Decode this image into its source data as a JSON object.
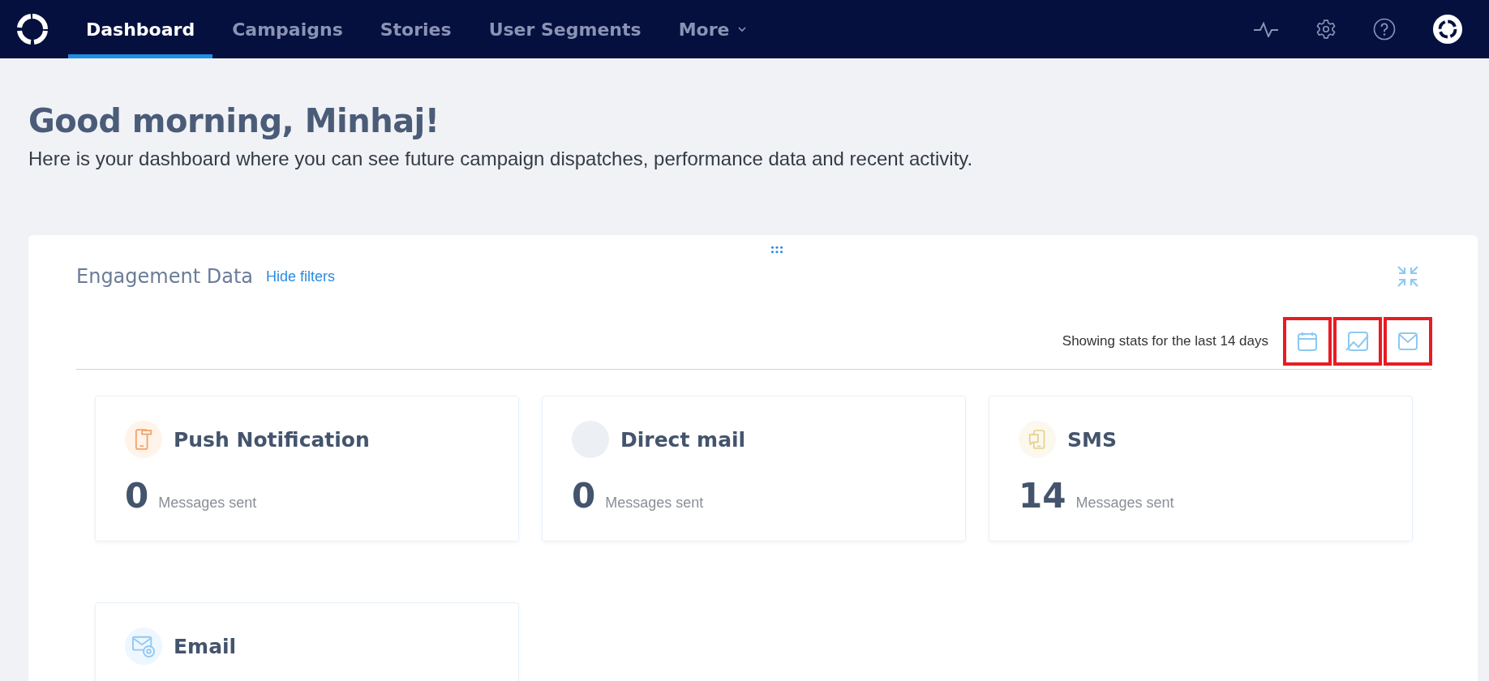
{
  "nav": {
    "tabs": [
      {
        "label": "Dashboard",
        "selected": true
      },
      {
        "label": "Campaigns",
        "selected": false
      },
      {
        "label": "Stories",
        "selected": false
      },
      {
        "label": "User Segments",
        "selected": false
      },
      {
        "label": "More",
        "selected": false,
        "dropdown": true
      }
    ]
  },
  "greeting": {
    "title": "Good morning, Minhaj!",
    "subtitle": "Here is your dashboard where you can see future campaign dispatches, performance data and recent activity."
  },
  "engagement": {
    "title": "Engagement Data",
    "filter_link": "Hide filters",
    "stats_range": "Showing stats for the last 14 days",
    "filters": [
      {
        "kind": "calendar",
        "highlighted": true
      },
      {
        "kind": "chart",
        "highlighted": true
      },
      {
        "kind": "mail",
        "highlighted": true
      }
    ],
    "channels": [
      {
        "kind": "push",
        "name": "Push Notification",
        "count": "0",
        "label": "Messages sent"
      },
      {
        "kind": "direct_mail",
        "name": "Direct mail",
        "count": "0",
        "label": "Messages sent"
      },
      {
        "kind": "sms",
        "name": "SMS",
        "count": "14",
        "label": "Messages sent"
      },
      {
        "kind": "email",
        "name": "Email"
      }
    ]
  }
}
